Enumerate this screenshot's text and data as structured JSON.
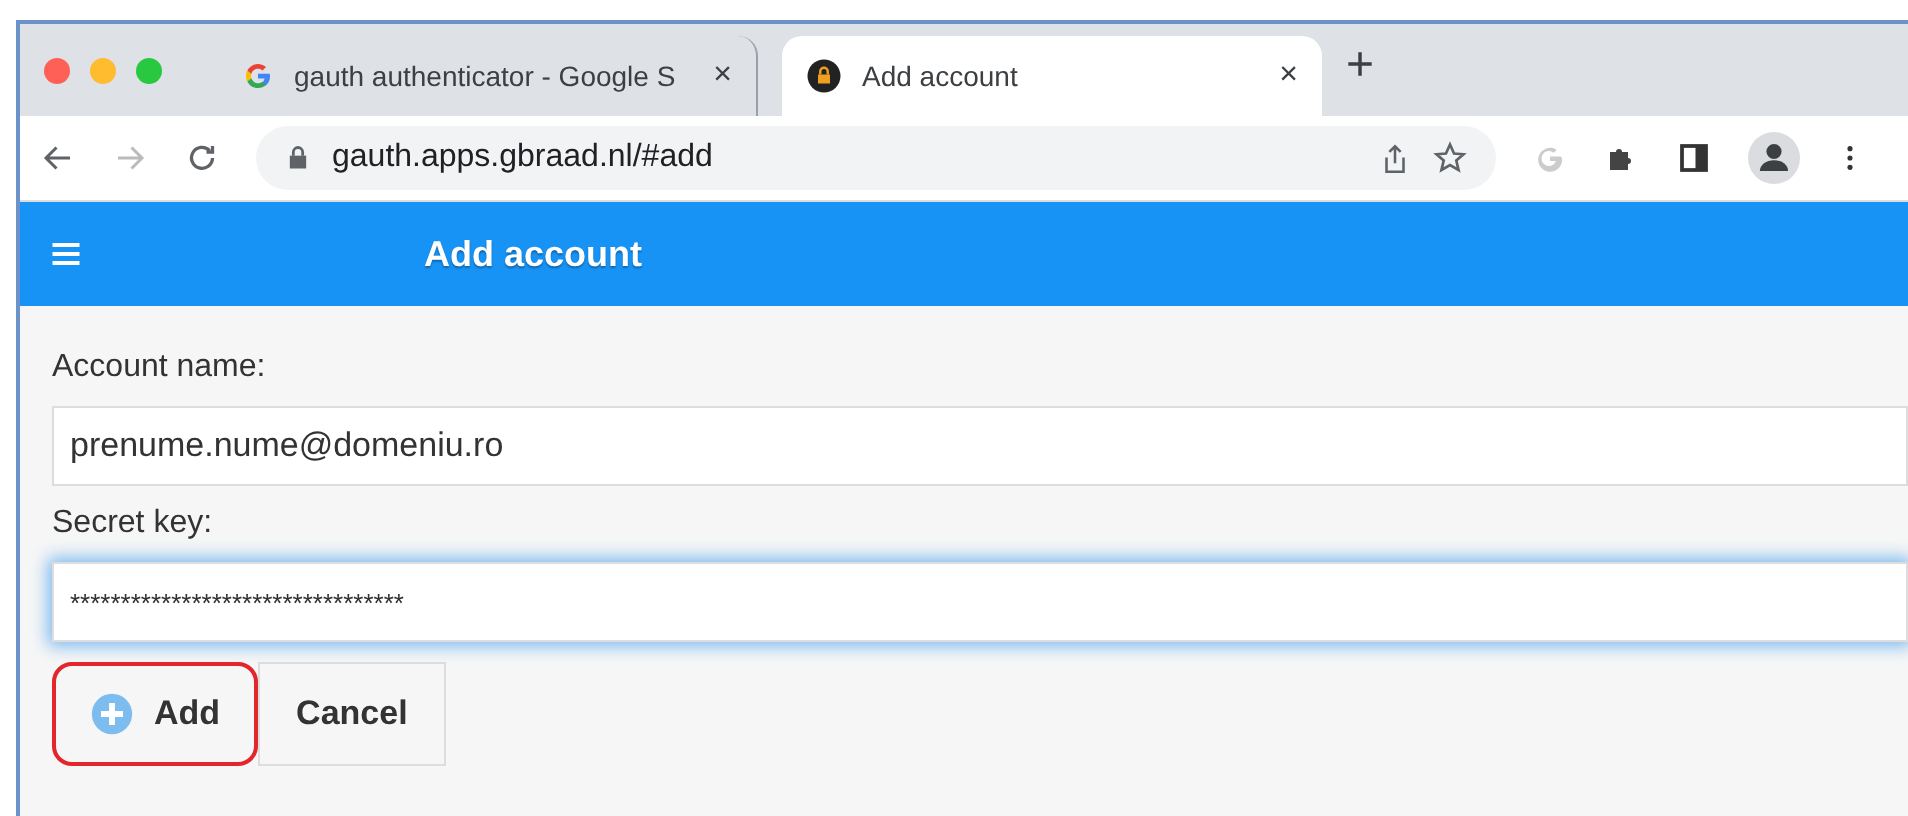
{
  "browser": {
    "tabs": [
      {
        "title": "gauth authenticator - Google S",
        "kind": "google",
        "selected": false,
        "close": "×"
      },
      {
        "title": "Add account",
        "kind": "lock",
        "selected": true,
        "close": "×"
      }
    ],
    "new_tab": "+",
    "address": "gauth.apps.gbraad.nl/#add"
  },
  "app": {
    "title": "Add account",
    "fields": [
      {
        "label": "Account name:",
        "value": "prenume.nume@domeniu.ro",
        "focused": false
      },
      {
        "label": "Secret key:",
        "value": "*********************************",
        "focused": true
      }
    ],
    "buttons": [
      {
        "label": "Add",
        "kind": "add",
        "highlighted": true
      },
      {
        "label": "Cancel",
        "kind": "plain",
        "highlighted": false
      }
    ]
  }
}
